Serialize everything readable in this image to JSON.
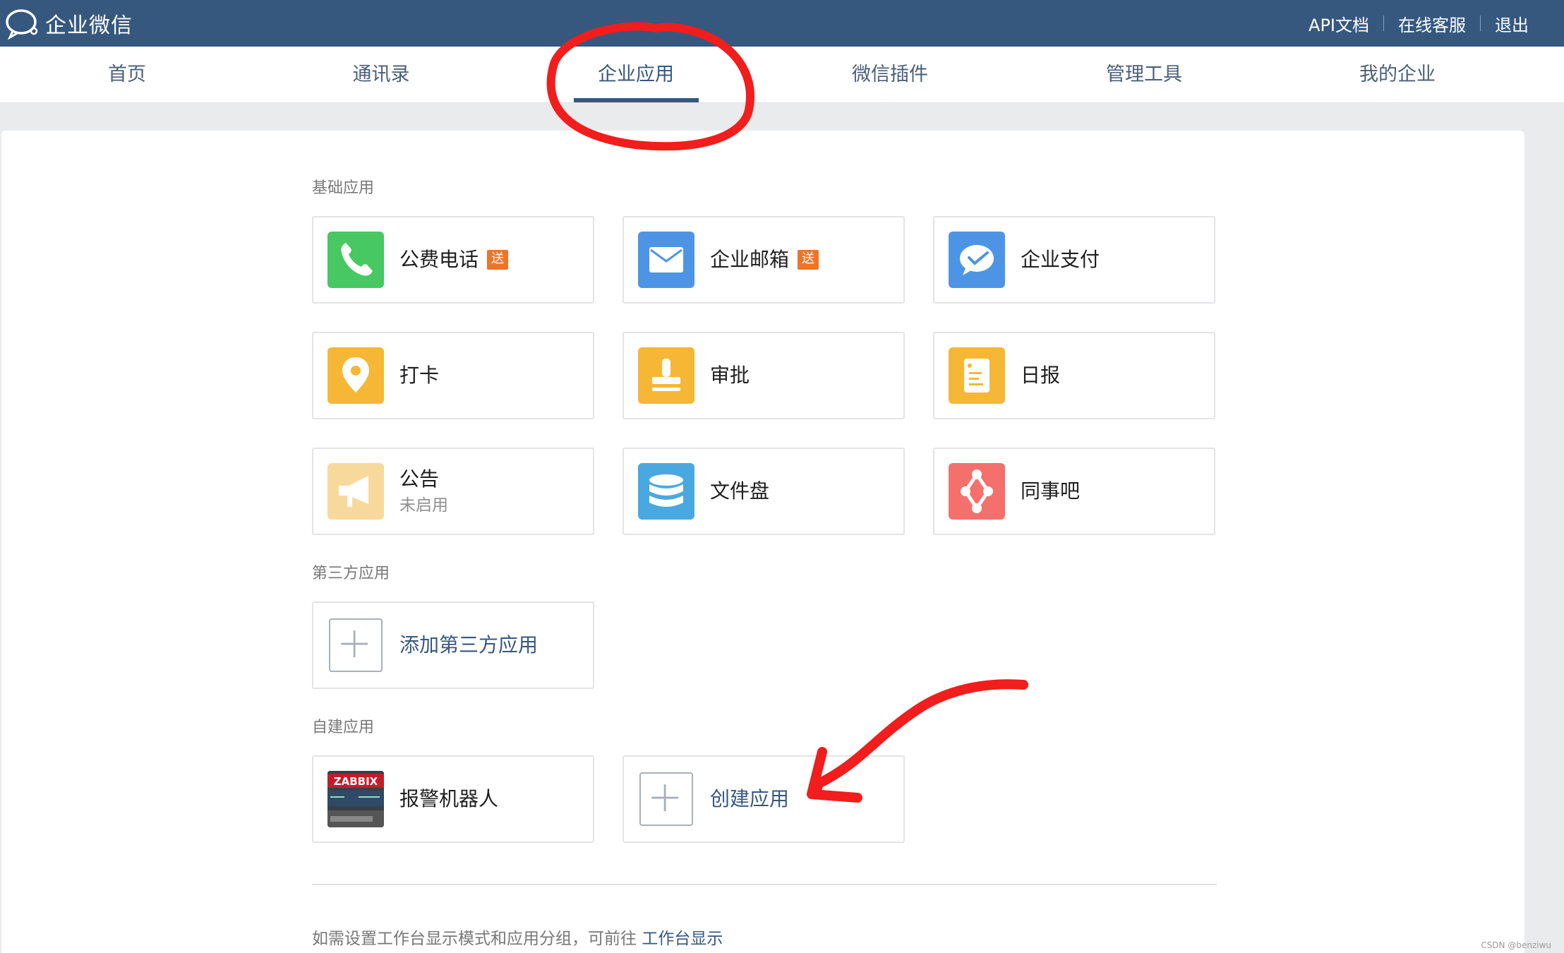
{
  "topbar": {
    "brand": "企业微信",
    "links": [
      "API文档",
      "在线客服",
      "退出"
    ]
  },
  "nav": {
    "items": [
      "首页",
      "通讯录",
      "企业应用",
      "微信插件",
      "管理工具",
      "我的企业"
    ],
    "active": "企业应用"
  },
  "sections": {
    "basic": "基础应用",
    "third_party": "第三方应用",
    "custom": "自建应用"
  },
  "apps": {
    "phone": {
      "name": "公费电话",
      "badge": "送",
      "icon": "phone-icon",
      "color": "#47c862"
    },
    "mail": {
      "name": "企业邮箱",
      "badge": "送",
      "icon": "mail-icon",
      "color": "#4d95e4"
    },
    "pay": {
      "name": "企业支付",
      "icon": "pay-icon",
      "color": "#4d95e4"
    },
    "checkin": {
      "name": "打卡",
      "icon": "location-pin-icon",
      "color": "#f5b735"
    },
    "approval": {
      "name": "审批",
      "icon": "stamp-icon",
      "color": "#f5b735"
    },
    "daily": {
      "name": "日报",
      "icon": "report-icon",
      "color": "#f5b735"
    },
    "notice": {
      "name": "公告",
      "status": "未启用",
      "icon": "megaphone-icon",
      "color": "#f8d99c"
    },
    "drive": {
      "name": "文件盘",
      "icon": "database-icon",
      "color": "#4aa8e0"
    },
    "colleague": {
      "name": "同事吧",
      "icon": "network-icon",
      "color": "#f4706c"
    }
  },
  "third_party_add": "添加第三方应用",
  "custom_apps": {
    "alarm_bot": {
      "name": "报警机器人",
      "icon": "zabbix-icon",
      "logo_text": "ZABBIX"
    },
    "create": "创建应用"
  },
  "footer": {
    "text": "如需设置工作台显示模式和应用分组，可前往",
    "link": "工作台显示"
  },
  "watermark": "CSDN @benziwu"
}
